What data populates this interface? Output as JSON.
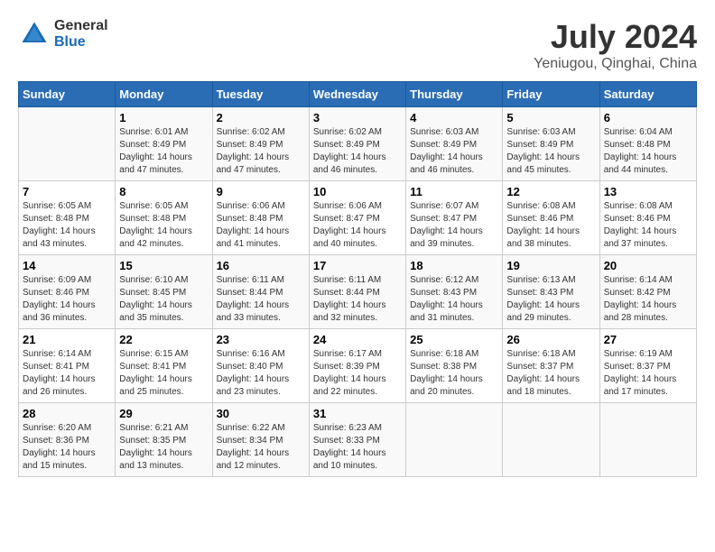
{
  "logo": {
    "general": "General",
    "blue": "Blue"
  },
  "title": "July 2024",
  "subtitle": "Yeniugou, Qinghai, China",
  "days_header": [
    "Sunday",
    "Monday",
    "Tuesday",
    "Wednesday",
    "Thursday",
    "Friday",
    "Saturday"
  ],
  "weeks": [
    [
      {
        "day": "",
        "sunrise": "",
        "sunset": "",
        "daylight": ""
      },
      {
        "day": "1",
        "sunrise": "Sunrise: 6:01 AM",
        "sunset": "Sunset: 8:49 PM",
        "daylight": "Daylight: 14 hours and 47 minutes."
      },
      {
        "day": "2",
        "sunrise": "Sunrise: 6:02 AM",
        "sunset": "Sunset: 8:49 PM",
        "daylight": "Daylight: 14 hours and 47 minutes."
      },
      {
        "day": "3",
        "sunrise": "Sunrise: 6:02 AM",
        "sunset": "Sunset: 8:49 PM",
        "daylight": "Daylight: 14 hours and 46 minutes."
      },
      {
        "day": "4",
        "sunrise": "Sunrise: 6:03 AM",
        "sunset": "Sunset: 8:49 PM",
        "daylight": "Daylight: 14 hours and 46 minutes."
      },
      {
        "day": "5",
        "sunrise": "Sunrise: 6:03 AM",
        "sunset": "Sunset: 8:49 PM",
        "daylight": "Daylight: 14 hours and 45 minutes."
      },
      {
        "day": "6",
        "sunrise": "Sunrise: 6:04 AM",
        "sunset": "Sunset: 8:48 PM",
        "daylight": "Daylight: 14 hours and 44 minutes."
      }
    ],
    [
      {
        "day": "7",
        "sunrise": "Sunrise: 6:05 AM",
        "sunset": "Sunset: 8:48 PM",
        "daylight": "Daylight: 14 hours and 43 minutes."
      },
      {
        "day": "8",
        "sunrise": "Sunrise: 6:05 AM",
        "sunset": "Sunset: 8:48 PM",
        "daylight": "Daylight: 14 hours and 42 minutes."
      },
      {
        "day": "9",
        "sunrise": "Sunrise: 6:06 AM",
        "sunset": "Sunset: 8:48 PM",
        "daylight": "Daylight: 14 hours and 41 minutes."
      },
      {
        "day": "10",
        "sunrise": "Sunrise: 6:06 AM",
        "sunset": "Sunset: 8:47 PM",
        "daylight": "Daylight: 14 hours and 40 minutes."
      },
      {
        "day": "11",
        "sunrise": "Sunrise: 6:07 AM",
        "sunset": "Sunset: 8:47 PM",
        "daylight": "Daylight: 14 hours and 39 minutes."
      },
      {
        "day": "12",
        "sunrise": "Sunrise: 6:08 AM",
        "sunset": "Sunset: 8:46 PM",
        "daylight": "Daylight: 14 hours and 38 minutes."
      },
      {
        "day": "13",
        "sunrise": "Sunrise: 6:08 AM",
        "sunset": "Sunset: 8:46 PM",
        "daylight": "Daylight: 14 hours and 37 minutes."
      }
    ],
    [
      {
        "day": "14",
        "sunrise": "Sunrise: 6:09 AM",
        "sunset": "Sunset: 8:46 PM",
        "daylight": "Daylight: 14 hours and 36 minutes."
      },
      {
        "day": "15",
        "sunrise": "Sunrise: 6:10 AM",
        "sunset": "Sunset: 8:45 PM",
        "daylight": "Daylight: 14 hours and 35 minutes."
      },
      {
        "day": "16",
        "sunrise": "Sunrise: 6:11 AM",
        "sunset": "Sunset: 8:44 PM",
        "daylight": "Daylight: 14 hours and 33 minutes."
      },
      {
        "day": "17",
        "sunrise": "Sunrise: 6:11 AM",
        "sunset": "Sunset: 8:44 PM",
        "daylight": "Daylight: 14 hours and 32 minutes."
      },
      {
        "day": "18",
        "sunrise": "Sunrise: 6:12 AM",
        "sunset": "Sunset: 8:43 PM",
        "daylight": "Daylight: 14 hours and 31 minutes."
      },
      {
        "day": "19",
        "sunrise": "Sunrise: 6:13 AM",
        "sunset": "Sunset: 8:43 PM",
        "daylight": "Daylight: 14 hours and 29 minutes."
      },
      {
        "day": "20",
        "sunrise": "Sunrise: 6:14 AM",
        "sunset": "Sunset: 8:42 PM",
        "daylight": "Daylight: 14 hours and 28 minutes."
      }
    ],
    [
      {
        "day": "21",
        "sunrise": "Sunrise: 6:14 AM",
        "sunset": "Sunset: 8:41 PM",
        "daylight": "Daylight: 14 hours and 26 minutes."
      },
      {
        "day": "22",
        "sunrise": "Sunrise: 6:15 AM",
        "sunset": "Sunset: 8:41 PM",
        "daylight": "Daylight: 14 hours and 25 minutes."
      },
      {
        "day": "23",
        "sunrise": "Sunrise: 6:16 AM",
        "sunset": "Sunset: 8:40 PM",
        "daylight": "Daylight: 14 hours and 23 minutes."
      },
      {
        "day": "24",
        "sunrise": "Sunrise: 6:17 AM",
        "sunset": "Sunset: 8:39 PM",
        "daylight": "Daylight: 14 hours and 22 minutes."
      },
      {
        "day": "25",
        "sunrise": "Sunrise: 6:18 AM",
        "sunset": "Sunset: 8:38 PM",
        "daylight": "Daylight: 14 hours and 20 minutes."
      },
      {
        "day": "26",
        "sunrise": "Sunrise: 6:18 AM",
        "sunset": "Sunset: 8:37 PM",
        "daylight": "Daylight: 14 hours and 18 minutes."
      },
      {
        "day": "27",
        "sunrise": "Sunrise: 6:19 AM",
        "sunset": "Sunset: 8:37 PM",
        "daylight": "Daylight: 14 hours and 17 minutes."
      }
    ],
    [
      {
        "day": "28",
        "sunrise": "Sunrise: 6:20 AM",
        "sunset": "Sunset: 8:36 PM",
        "daylight": "Daylight: 14 hours and 15 minutes."
      },
      {
        "day": "29",
        "sunrise": "Sunrise: 6:21 AM",
        "sunset": "Sunset: 8:35 PM",
        "daylight": "Daylight: 14 hours and 13 minutes."
      },
      {
        "day": "30",
        "sunrise": "Sunrise: 6:22 AM",
        "sunset": "Sunset: 8:34 PM",
        "daylight": "Daylight: 14 hours and 12 minutes."
      },
      {
        "day": "31",
        "sunrise": "Sunrise: 6:23 AM",
        "sunset": "Sunset: 8:33 PM",
        "daylight": "Daylight: 14 hours and 10 minutes."
      },
      {
        "day": "",
        "sunrise": "",
        "sunset": "",
        "daylight": ""
      },
      {
        "day": "",
        "sunrise": "",
        "sunset": "",
        "daylight": ""
      },
      {
        "day": "",
        "sunrise": "",
        "sunset": "",
        "daylight": ""
      }
    ]
  ]
}
